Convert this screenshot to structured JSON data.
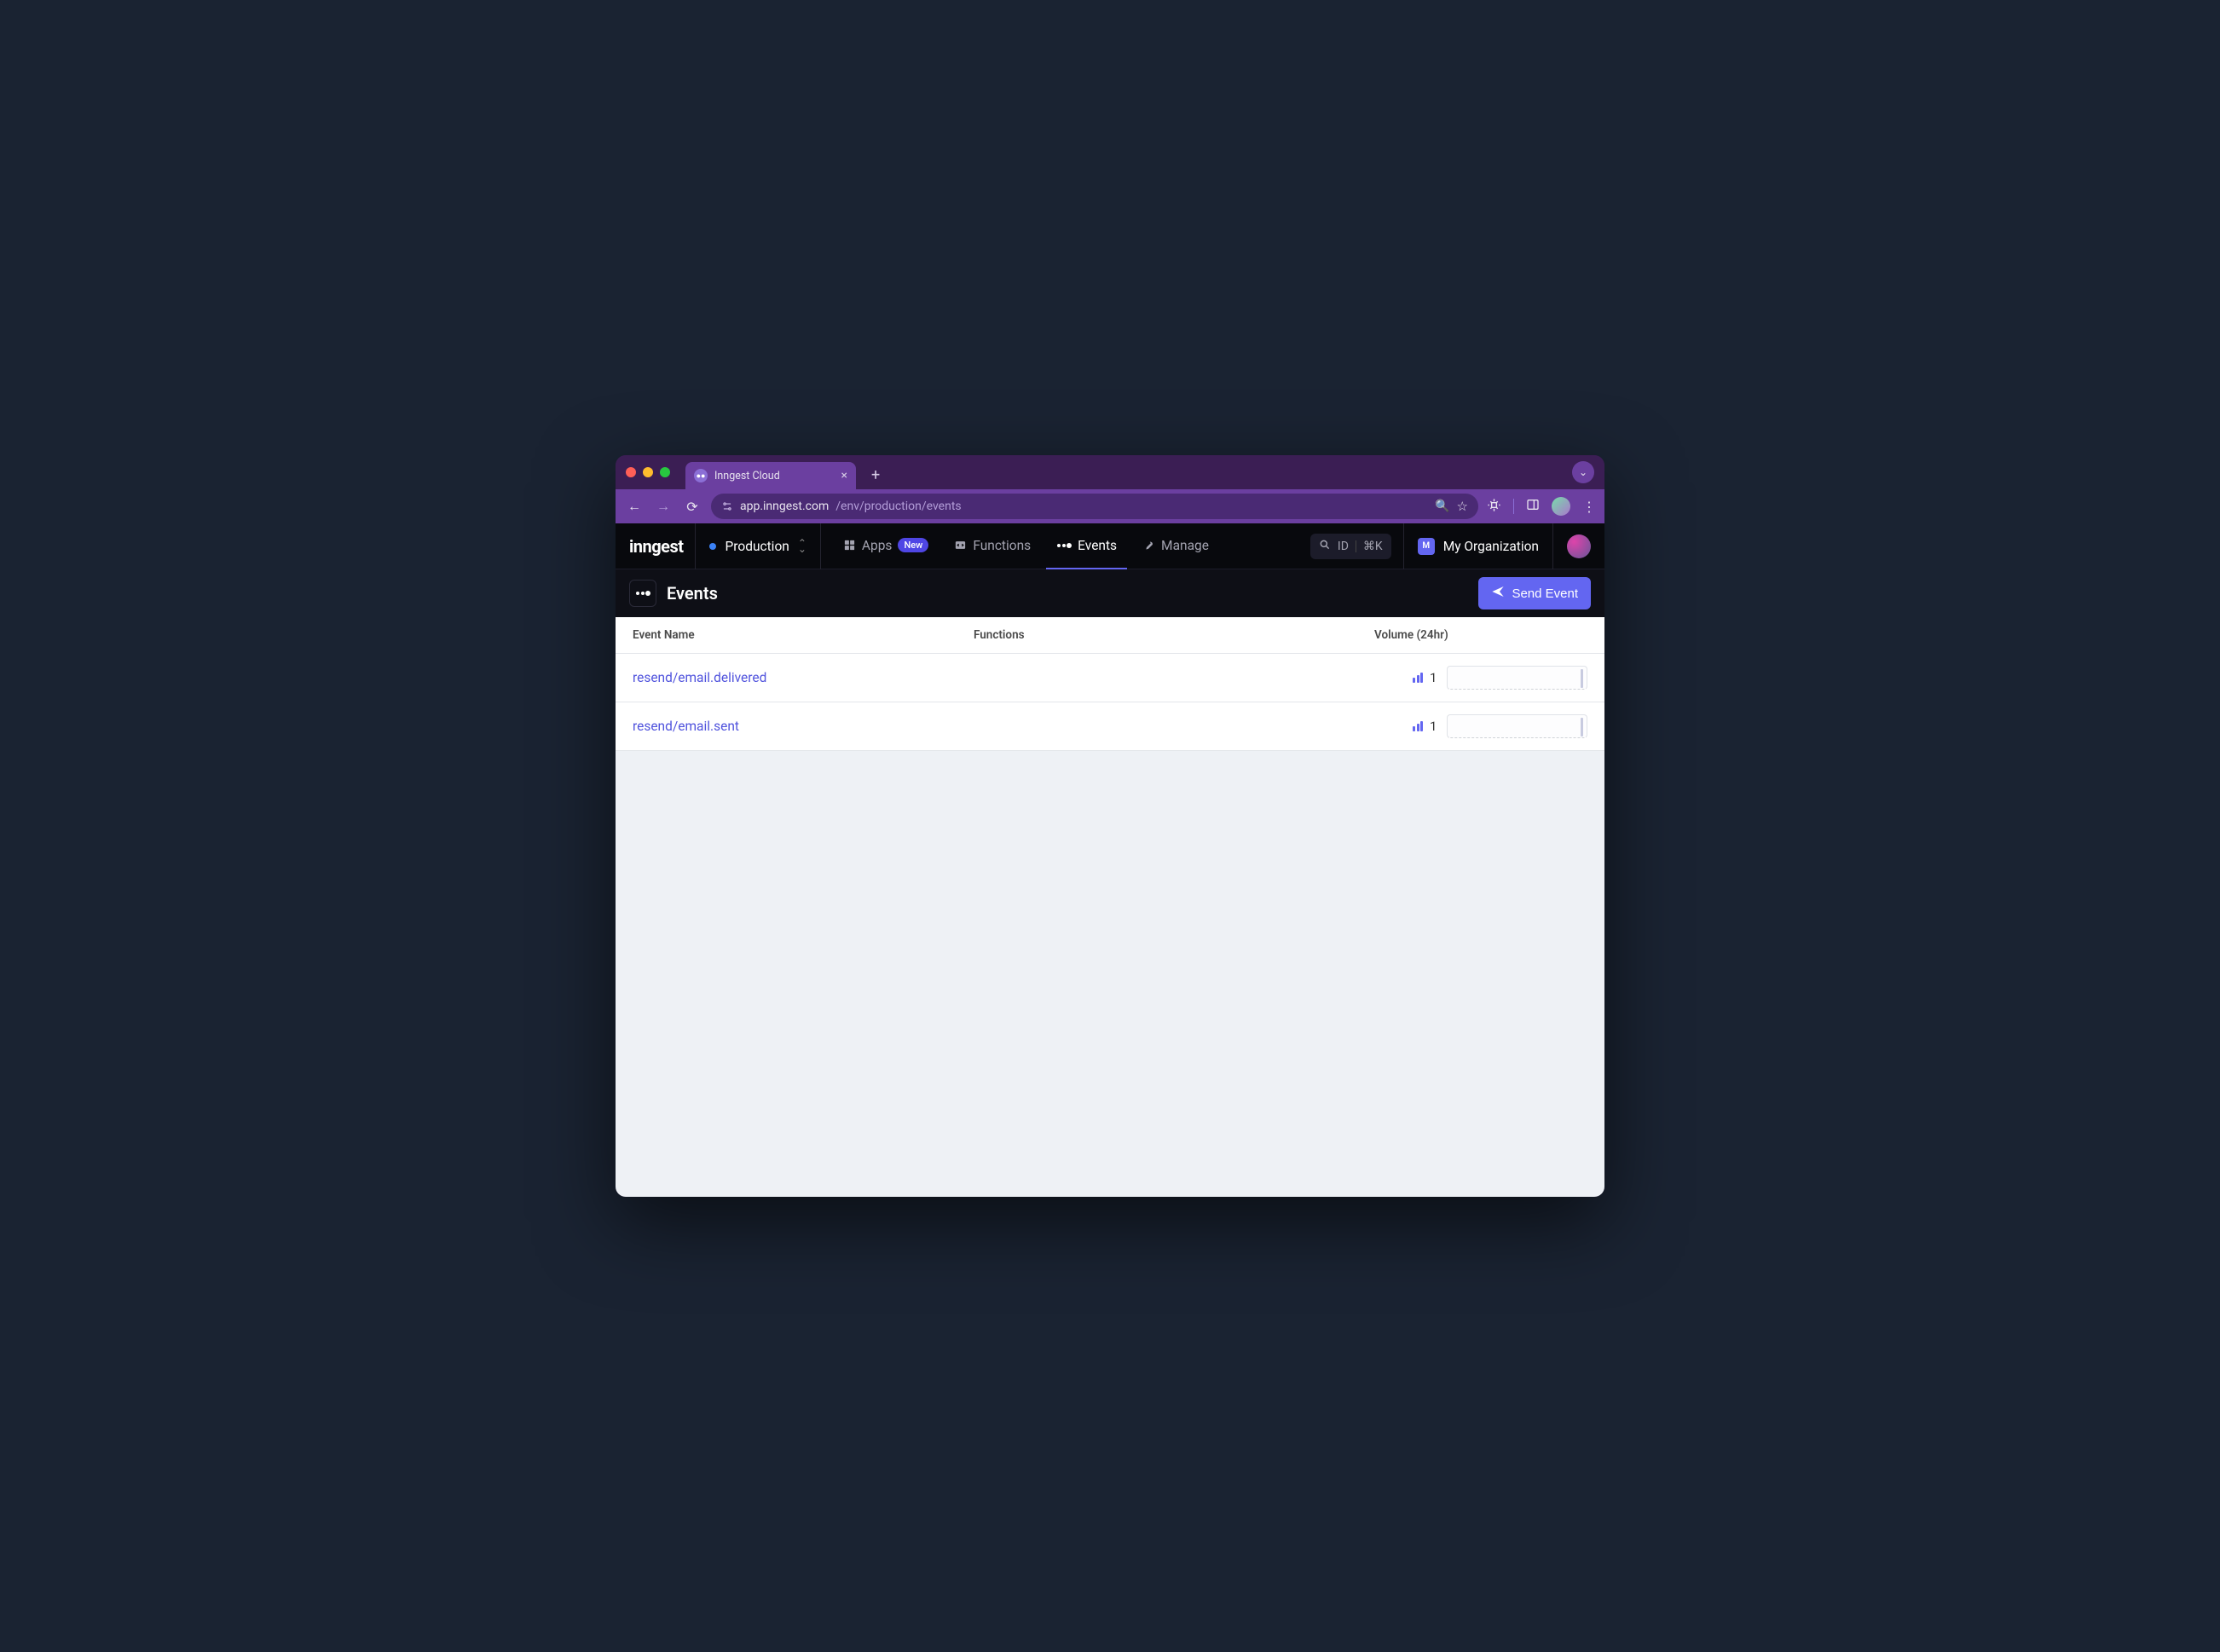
{
  "browser": {
    "tab_title": "Inngest Cloud",
    "url_host": "app.inngest.com",
    "url_path": "/env/production/events"
  },
  "app": {
    "logo_text": "inngest",
    "env_label": "Production",
    "nav": {
      "apps": "Apps",
      "apps_badge": "New",
      "functions": "Functions",
      "events": "Events",
      "manage": "Manage"
    },
    "search": {
      "id": "ID",
      "shortcut": "⌘K"
    },
    "org_badge": "M",
    "org_name": "My Organization"
  },
  "page": {
    "title": "Events",
    "send_button": "Send Event",
    "columns": {
      "name": "Event Name",
      "functions": "Functions",
      "volume": "Volume (24hr)"
    },
    "rows": [
      {
        "name": "resend/email.delivered",
        "functions": "",
        "volume": "1"
      },
      {
        "name": "resend/email.sent",
        "functions": "",
        "volume": "1"
      }
    ]
  }
}
